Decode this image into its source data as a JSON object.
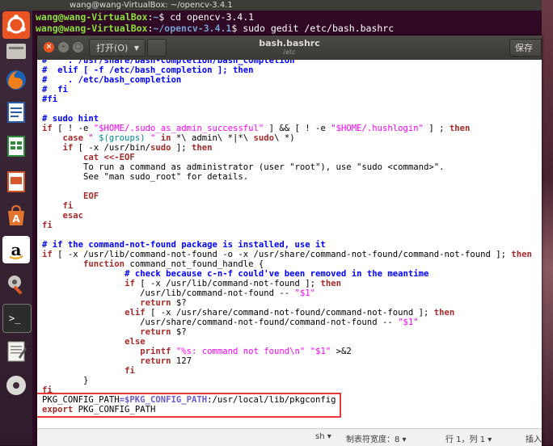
{
  "topbar": {
    "title": "wang@wang-VirtualBox: ~/opencv-3.4.1"
  },
  "terminal": {
    "lines": [
      {
        "user": "wang@wang-VirtualBox",
        "path": "~",
        "cmd": "$ cd opencv-3.4.1"
      },
      {
        "user": "wang@wang-VirtualBox",
        "path": "~/opencv-3.4.1",
        "cmd": "$ sudo gedit /etc/bash.bashrc"
      }
    ]
  },
  "gedit": {
    "open_label": "打开(O)",
    "title": "bash.bashrc",
    "path": "/etc",
    "save_label": "保存(S)"
  },
  "code_lines": [
    [
      {
        "t": "#    . /usr/share/bash-completion/bash_completion",
        "c": "cm"
      }
    ],
    [
      {
        "t": "#  elif [ -f /etc/bash_completion ]; then",
        "c": "cm"
      }
    ],
    [
      {
        "t": "#    . /etc/bash_completion",
        "c": "cm"
      }
    ],
    [
      {
        "t": "#  fi",
        "c": "cm"
      }
    ],
    [
      {
        "t": "#fi",
        "c": "cm"
      }
    ],
    [
      {
        "t": "",
        "c": ""
      }
    ],
    [
      {
        "t": "# sudo hint",
        "c": "cm"
      }
    ],
    [
      {
        "t": "if",
        "c": "kw"
      },
      {
        "t": " [ ! -e ",
        "c": ""
      },
      {
        "t": "\"$HOME/.sudo_as_admin_successful\"",
        "c": "st"
      },
      {
        "t": " ] && [ ! -e ",
        "c": ""
      },
      {
        "t": "\"$HOME/.hushlogin\"",
        "c": "st"
      },
      {
        "t": " ] ; ",
        "c": ""
      },
      {
        "t": "then",
        "c": "kw"
      }
    ],
    [
      {
        "t": "    ",
        "c": ""
      },
      {
        "t": "case",
        "c": "kw"
      },
      {
        "t": " \" ",
        "c": "st"
      },
      {
        "t": "$(groups)",
        "c": "vr"
      },
      {
        "t": " \"",
        "c": "st"
      },
      {
        "t": " in",
        "c": "kw"
      },
      {
        "t": " *\\ admin\\ *|*\\ ",
        "c": ""
      },
      {
        "t": "sudo",
        "c": "kw"
      },
      {
        "t": "\\ *)",
        "c": ""
      }
    ],
    [
      {
        "t": "    ",
        "c": ""
      },
      {
        "t": "if",
        "c": "kw"
      },
      {
        "t": " [ -x /usr/bin/",
        "c": ""
      },
      {
        "t": "sudo",
        "c": "kw"
      },
      {
        "t": " ]; ",
        "c": ""
      },
      {
        "t": "then",
        "c": "kw"
      }
    ],
    [
      {
        "t": "        ",
        "c": ""
      },
      {
        "t": "cat <<-EOF",
        "c": "kw"
      }
    ],
    [
      {
        "t": "        To run a command as administrator (user \"root\"), use \"sudo <command>\".",
        "c": ""
      }
    ],
    [
      {
        "t": "        See \"man sudo_root\" for details.",
        "c": ""
      }
    ],
    [
      {
        "t": "",
        "c": ""
      }
    ],
    [
      {
        "t": "        ",
        "c": ""
      },
      {
        "t": "EOF",
        "c": "kw"
      }
    ],
    [
      {
        "t": "    ",
        "c": ""
      },
      {
        "t": "fi",
        "c": "kw"
      }
    ],
    [
      {
        "t": "    ",
        "c": ""
      },
      {
        "t": "esac",
        "c": "kw"
      }
    ],
    [
      {
        "t": "fi",
        "c": "kw"
      }
    ],
    [
      {
        "t": "",
        "c": ""
      }
    ],
    [
      {
        "t": "# if the command-not-found package is installed, use it",
        "c": "cm"
      }
    ],
    [
      {
        "t": "if",
        "c": "kw"
      },
      {
        "t": " [ -x /usr/lib/command-not-found -o -x /usr/share/command-not-found/command-not-found ]; ",
        "c": ""
      },
      {
        "t": "then",
        "c": "kw"
      }
    ],
    [
      {
        "t": "        ",
        "c": ""
      },
      {
        "t": "function",
        "c": "kw"
      },
      {
        "t": " command_not_found_handle {",
        "c": ""
      }
    ],
    [
      {
        "t": "                ",
        "c": ""
      },
      {
        "t": "# check because c-n-f could've been removed in the meantime",
        "c": "cm"
      }
    ],
    [
      {
        "t": "                ",
        "c": ""
      },
      {
        "t": "if",
        "c": "kw"
      },
      {
        "t": " [ -x /usr/lib/command-not-found ]; ",
        "c": ""
      },
      {
        "t": "then",
        "c": "kw"
      }
    ],
    [
      {
        "t": "                   /usr/lib/command-not-found -- ",
        "c": ""
      },
      {
        "t": "\"$1\"",
        "c": "st"
      }
    ],
    [
      {
        "t": "                   ",
        "c": ""
      },
      {
        "t": "return",
        "c": "kw"
      },
      {
        "t": " $?",
        "c": ""
      }
    ],
    [
      {
        "t": "                ",
        "c": ""
      },
      {
        "t": "elif",
        "c": "kw"
      },
      {
        "t": " [ -x /usr/share/command-not-found/command-not-found ]; ",
        "c": ""
      },
      {
        "t": "then",
        "c": "kw"
      }
    ],
    [
      {
        "t": "                   /usr/share/command-not-found/command-not-found -- ",
        "c": ""
      },
      {
        "t": "\"$1\"",
        "c": "st"
      }
    ],
    [
      {
        "t": "                   ",
        "c": ""
      },
      {
        "t": "return",
        "c": "kw"
      },
      {
        "t": " $?",
        "c": ""
      }
    ],
    [
      {
        "t": "                ",
        "c": ""
      },
      {
        "t": "else",
        "c": "kw"
      }
    ],
    [
      {
        "t": "                   ",
        "c": ""
      },
      {
        "t": "printf",
        "c": "kw"
      },
      {
        "t": " ",
        "c": ""
      },
      {
        "t": "\"%s: command not found\\n\" \"$1\"",
        "c": "st"
      },
      {
        "t": " >&2",
        "c": ""
      }
    ],
    [
      {
        "t": "                   ",
        "c": ""
      },
      {
        "t": "return",
        "c": "kw"
      },
      {
        "t": " 127",
        "c": ""
      }
    ],
    [
      {
        "t": "                ",
        "c": ""
      },
      {
        "t": "fi",
        "c": "kw"
      }
    ],
    [
      {
        "t": "        }",
        "c": ""
      }
    ],
    [
      {
        "t": "fi",
        "c": "kw"
      }
    ],
    [
      {
        "t": "PKG_CONFIG_PATH",
        "c": ""
      },
      {
        "t": "=$PKG_CONFIG_PATH",
        "c": "pt"
      },
      {
        "t": ":/usr/local/lib/pkgconfig",
        "c": ""
      }
    ],
    [
      {
        "t": "export",
        "c": "kw"
      },
      {
        "t": " PKG_CONFIG_PATH",
        "c": ""
      }
    ]
  ],
  "statusbar": {
    "lang": "sh",
    "tab_width": "制表符宽度：8",
    "position": "行 1，列 1",
    "mode": "插入"
  }
}
